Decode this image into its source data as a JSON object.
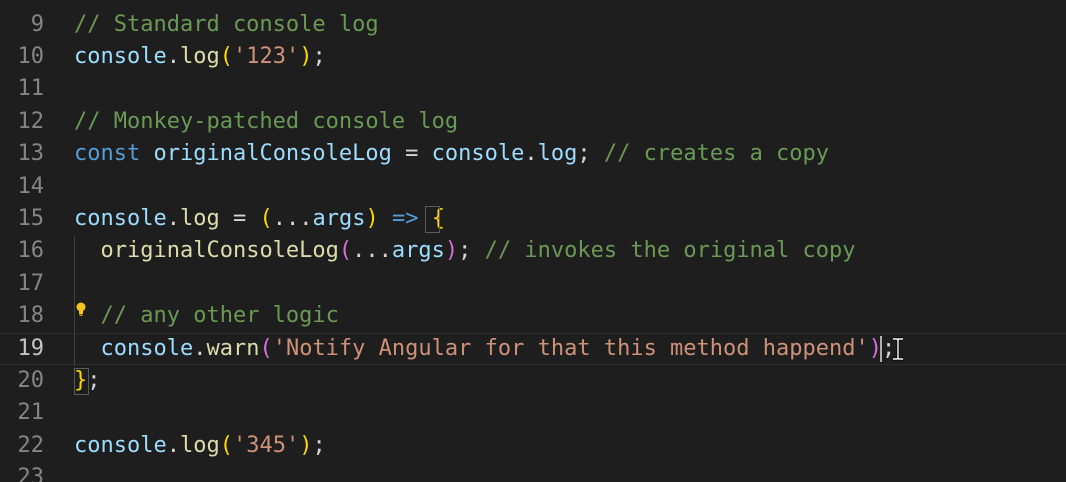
{
  "editor": {
    "active_line": "19",
    "lines": [
      {
        "num": "9",
        "tokens": [
          {
            "t": "// Standard console log",
            "c": "c"
          }
        ]
      },
      {
        "num": "10",
        "tokens": [
          {
            "t": "console",
            "c": "v"
          },
          {
            "t": ".",
            "c": "t"
          },
          {
            "t": "log",
            "c": "f"
          },
          {
            "t": "(",
            "c": "p1"
          },
          {
            "t": "'123'",
            "c": "s"
          },
          {
            "t": ")",
            "c": "p1"
          },
          {
            "t": ";",
            "c": "t"
          }
        ]
      },
      {
        "num": "11",
        "tokens": []
      },
      {
        "num": "12",
        "tokens": [
          {
            "t": "// Monkey-patched console log",
            "c": "c"
          }
        ]
      },
      {
        "num": "13",
        "tokens": [
          {
            "t": "const ",
            "c": "k"
          },
          {
            "t": "originalConsoleLog",
            "c": "v"
          },
          {
            "t": " = ",
            "c": "t"
          },
          {
            "t": "console",
            "c": "v"
          },
          {
            "t": ".",
            "c": "t"
          },
          {
            "t": "log",
            "c": "v"
          },
          {
            "t": "; ",
            "c": "t"
          },
          {
            "t": "// creates a copy",
            "c": "c"
          }
        ]
      },
      {
        "num": "14",
        "tokens": []
      },
      {
        "num": "15",
        "tokens": [
          {
            "t": "console",
            "c": "v"
          },
          {
            "t": ".",
            "c": "t"
          },
          {
            "t": "log",
            "c": "f"
          },
          {
            "t": " = ",
            "c": "t"
          },
          {
            "t": "(",
            "c": "p1"
          },
          {
            "t": "...",
            "c": "t"
          },
          {
            "t": "args",
            "c": "v"
          },
          {
            "t": ")",
            "c": "p1"
          },
          {
            "t": " ",
            "c": "t"
          },
          {
            "t": "=>",
            "c": "k"
          },
          {
            "t": " ",
            "c": "t"
          },
          {
            "t": "{",
            "c": "p1"
          }
        ]
      },
      {
        "num": "16",
        "tokens": [
          {
            "t": "  ",
            "c": "t"
          },
          {
            "t": "originalConsoleLog",
            "c": "f"
          },
          {
            "t": "(",
            "c": "p2"
          },
          {
            "t": "...",
            "c": "t"
          },
          {
            "t": "args",
            "c": "v"
          },
          {
            "t": ")",
            "c": "p2"
          },
          {
            "t": "; ",
            "c": "t"
          },
          {
            "t": "// invokes the original copy",
            "c": "c"
          }
        ]
      },
      {
        "num": "17",
        "tokens": []
      },
      {
        "num": "18",
        "tokens": [
          {
            "t": "  ",
            "c": "t"
          },
          {
            "t": "// any other logic",
            "c": "c"
          }
        ]
      },
      {
        "num": "19",
        "tokens": [
          {
            "t": "  ",
            "c": "t"
          },
          {
            "t": "console",
            "c": "v"
          },
          {
            "t": ".",
            "c": "t"
          },
          {
            "t": "warn",
            "c": "f"
          },
          {
            "t": "(",
            "c": "p2"
          },
          {
            "t": "'Notify Angular for that this method happend'",
            "c": "s"
          },
          {
            "t": ")",
            "c": "p2"
          },
          {
            "t": ";",
            "c": "t"
          }
        ]
      },
      {
        "num": "20",
        "tokens": [
          {
            "t": "}",
            "c": "p1"
          },
          {
            "t": ";",
            "c": "t"
          }
        ]
      },
      {
        "num": "21",
        "tokens": []
      },
      {
        "num": "22",
        "tokens": [
          {
            "t": "console",
            "c": "v"
          },
          {
            "t": ".",
            "c": "t"
          },
          {
            "t": "log",
            "c": "f"
          },
          {
            "t": "(",
            "c": "p1"
          },
          {
            "t": "'345'",
            "c": "s"
          },
          {
            "t": ")",
            "c": "p1"
          },
          {
            "t": ";",
            "c": "t"
          }
        ]
      },
      {
        "num": "23",
        "tokens": []
      }
    ]
  },
  "icons": {
    "lightbulb": "lightbulb-icon",
    "cursor": "text-cursor",
    "mouse": "ibeam-pointer-icon"
  },
  "colors": {
    "background": "#1e1e1e",
    "comment": "#6a9955",
    "variable": "#9cdcfe",
    "function": "#dcdcaa",
    "string": "#ce9178",
    "keyword": "#569cd6",
    "bracket_level1": "#ffd700",
    "bracket_level2": "#da70d6",
    "line_number": "#858585"
  }
}
